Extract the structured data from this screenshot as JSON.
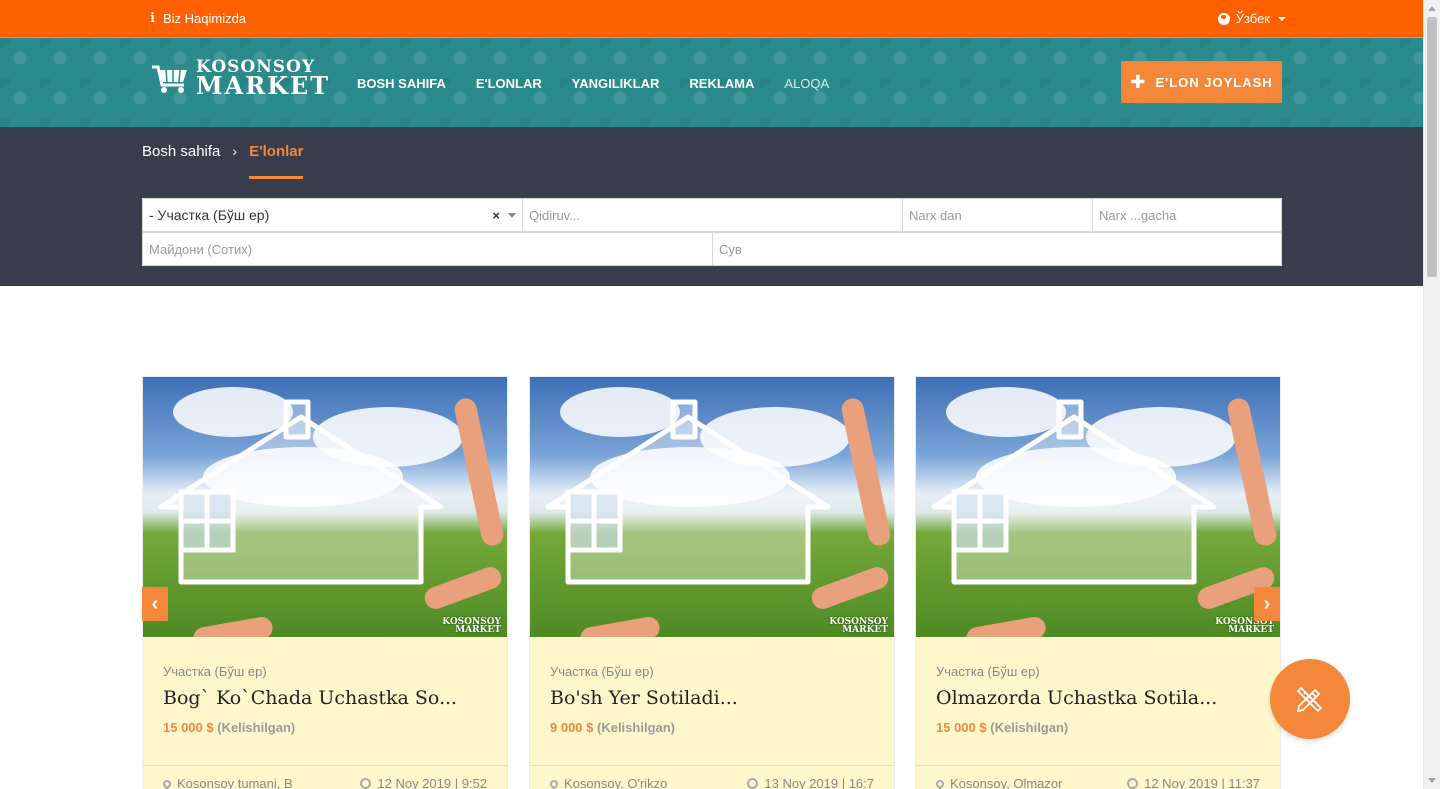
{
  "topbar": {
    "about_label": "Biz Haqimizda",
    "language": "Ўзбек",
    "bg_color": "#ff6000"
  },
  "header": {
    "logo": {
      "line1": "KOSONSOY",
      "line2": "MARKET"
    },
    "nav": [
      "BOSH SAHIFA",
      "E'LONLAR",
      "YANGILIKLAR",
      "REKLAMA",
      "ALOQA"
    ],
    "post_button": "E'LON JOYLASH",
    "bg_color": "#2b8a8c",
    "accent": "#f5873a"
  },
  "breadcrumb": {
    "home": "Bosh sahifa",
    "current": "E'lonlar"
  },
  "filters": {
    "category_value": "- Участка (Бўш ер)",
    "clear_symbol": "×",
    "search_placeholder": "Qidiruv...",
    "price_from_placeholder": "Narx dan",
    "price_to_placeholder": "Narx ...gacha",
    "area_placeholder": "Майдони (Сотих)",
    "water_placeholder": "Сув"
  },
  "listings": [
    {
      "category": "Участка (Бўш ер)",
      "title": "Bog` Ko`Chada Uchastka So...",
      "price": "15 000 $",
      "price_note": "(Kelishilgan)",
      "location": "Kosonsoy tumani, B",
      "date": "12 Noy 2019 | 9:52"
    },
    {
      "category": "Участка (Бўш ер)",
      "title": "Bo'sh Yer Sotiladi...",
      "price": "9 000 $",
      "price_note": "(Kelishilgan)",
      "location": "Kosonsoy, O'rikzo",
      "date": "13 Noy 2019 | 16:7"
    },
    {
      "category": "Участка (Бўш ер)",
      "title": "Olmazorda Uchastka Sotila...",
      "price": "15 000 $",
      "price_note": "(Kelishilgan)",
      "location": "Kosonsoy, Olmazor",
      "date": "12 Noy 2019 | 11:37"
    }
  ],
  "watermark": {
    "line1": "KOSONSOY",
    "line2": "MARKET"
  },
  "carousel": {
    "prev": "‹",
    "next": "›"
  }
}
